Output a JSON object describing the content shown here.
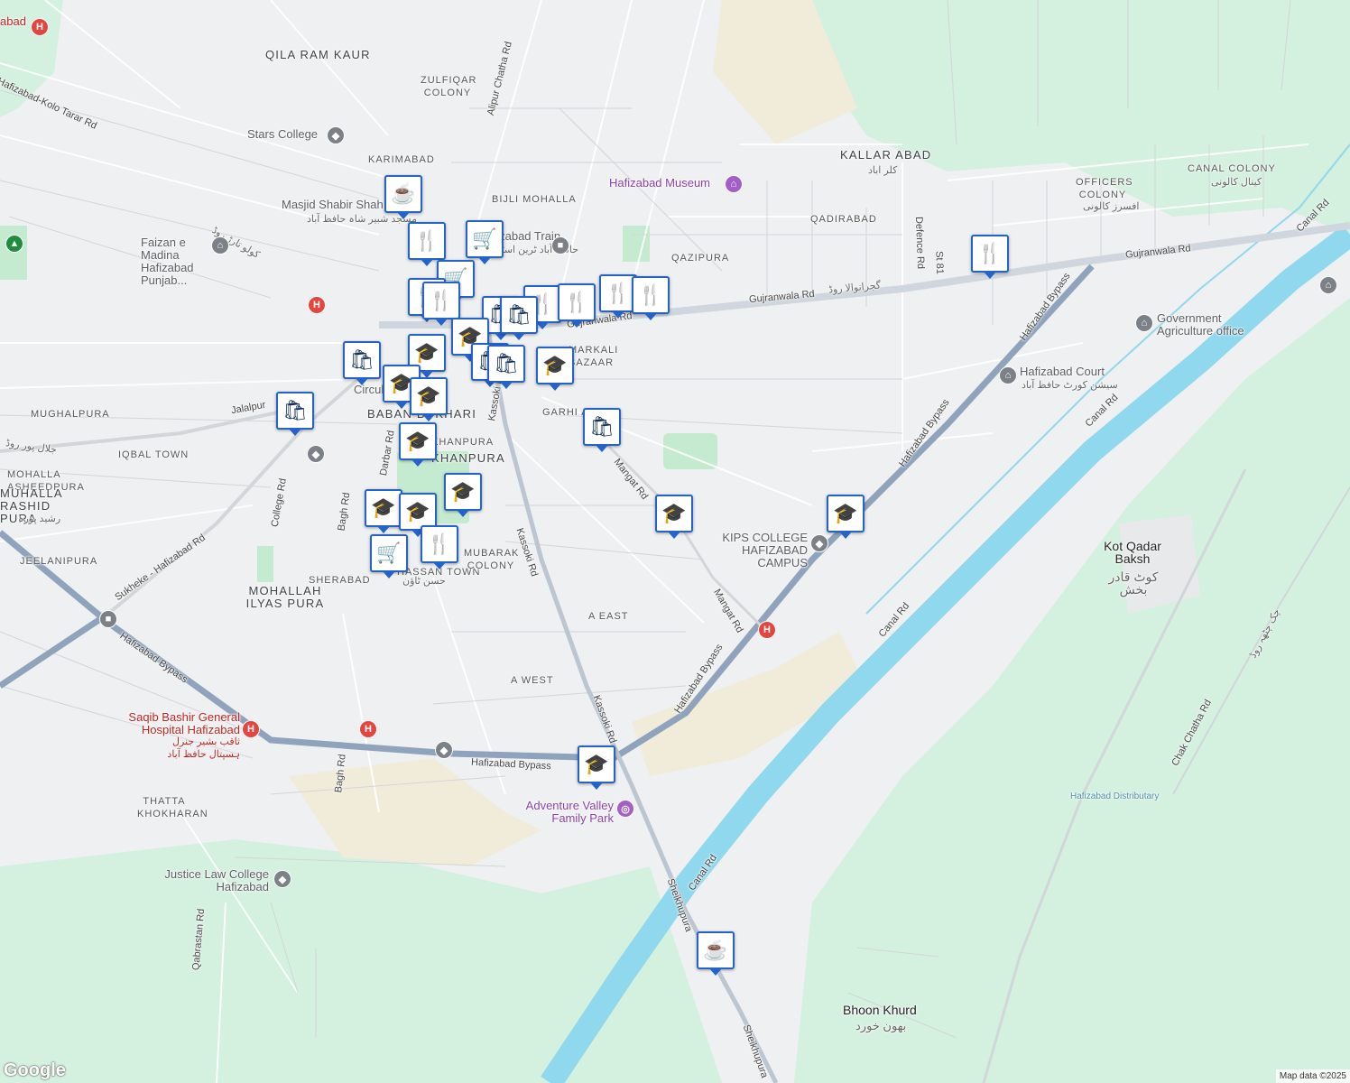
{
  "areas": {
    "qila_ram_kaur": "QILA RAM KAUR",
    "zulfiqar_colony": "ZULFIQAR COLONY",
    "karimabad": "KARIMABAD",
    "bijli_mohalla": "BIJLI MOHALLA",
    "kallar_abad": "KALLAR ABAD",
    "kallar_abad_urdu": "کلر اباد",
    "canal_colony": "CANAL COLONY",
    "canal_colony_urdu": "کینال کالونی",
    "officers_colony": "OFFICERS COLONY",
    "officers_colony_urdu": "افسرز کالونی",
    "qadirabad": "QADIRABAD",
    "qazipura": "QAZIPURA",
    "mughalpura": "MUGHALPURA",
    "iqbal_town": "IQBAL TOWN",
    "baban_bukhari": "BABAN BUKHARI",
    "khanpura": "KHANPURA",
    "khanpura_small": "KHANPURA",
    "mohalla_nasheedpura": "MOHALLA ASHEEDPURA",
    "muhalla_rashid_pura": "MUHALLA RASHID PURA",
    "rashid_pura_urdu": "رشید پورہ",
    "jeelanipura": "JEELANIPURA",
    "sherabad": "SHERABAD",
    "hassan_town": "HASSAN TOWN",
    "hassan_town_urdu": "حسن ٹاؤن",
    "mubarak_colony": "MUBARAK COLONY",
    "mohallah_ilyas_pura": "MOHALLAH ILYAS PURA",
    "a_east": "A EAST",
    "a_west": "A WEST",
    "thatta_khokharan": "THATTA KHOKHARAN",
    "garhi_awan": "GARHI A",
    "markali_bazaar": "MARKALI BAZAAR",
    "kot_qadar_baksh": "Kot Qadar Baksh",
    "kot_qadar_baksh_urdu": "کوٹ قادر بخش",
    "bhoon_khurd": "Bhoon Khurd",
    "bhoon_khurd_urdu": "بھون خورد",
    "circular": "Circul"
  },
  "roads": {
    "alipur_chatha_rd": "Alipur Chatha Rd",
    "gujranwala_rd_1": "Gujranwala Rd",
    "gujranwala_rd_2": "Gujranwala Rd",
    "gujranwala_rd_3": "Gujranwala Rd",
    "gujranwala_urdu": "گجرانوالا روڈ",
    "hafizabad_kolo_tarar_rd": "Hafizabad-Kolo Tarar Rd",
    "kolo_tarar_urdu": "کولو تارڑ روڈ",
    "jalalpur_rd": "Jalalpur",
    "jalalpur_urdu": "جلال پور روڈ",
    "darbar_rd": "Darbar Rd",
    "college_rd": "College Rd",
    "kassoki_rd_1": "Kassoki Rd",
    "kassoki_rd_2": "Kassoki Rd",
    "kassoki_rd_3": "Kassoki Rd",
    "mangat_rd_1": "Mangat Rd",
    "mangat_rd_2": "Mangat Rd",
    "sukheke_hafizabad_rd": "Sukheke - Hafizabad Rd",
    "hafizabad_bypass_1": "Hafizabad Bypass",
    "hafizabad_bypass_2": "Hafizabad Bypass",
    "hafizabad_bypass_3": "Hafizabad Bypass",
    "hafizabad_bypass_4": "Hafizabad Bypass",
    "hafizabad_bypass_5": "Hafizabad Bypass",
    "bagh_rd_1": "Bagh Rd",
    "bagh_rd_2": "Bagh Rd",
    "qabrastan_rd": "Qabrastan Rd",
    "canal_rd_1": "Canal Rd",
    "canal_rd_2": "Canal Rd",
    "canal_rd_3": "Canal Rd",
    "canal_rd_4": "Canal Rd",
    "sheikhupura_1": "Sheikhupura",
    "sheikhupura_2": "Sheikhupura",
    "defence_rd": "Defence Rd",
    "st_81": "St 81",
    "chak_chatha_rd": "Chak Chatha Rd",
    "chak_chatha_urdu": "چک چٹھہ روڈ"
  },
  "pois": {
    "stars_college": "Stars College",
    "masjid_shabir_shah": "Masjid Shabir Shah",
    "masjid_urdu": "مسجد شبیر شاہ حافظ آباد",
    "faizan_e_madina": "Faizan e Madina Hafizabad Punjab...",
    "hafizabad_museum": "Hafizabad Museum",
    "hafizabad_train": "Hafizabad Train",
    "train_urdu": "حافظ آباد ٹرین اسٹیشن",
    "government_agriculture": "Government Agriculture office",
    "hafizabad_court": "Hafizabad Court",
    "court_urdu": "سیشن کورٹ حافظ آباد",
    "kips_college": "KIPS COLLEGE HAFIZABAD CAMPUS",
    "saqib_bashir_hospital": "Saqib Bashir General Hospital Hafizabad",
    "saqib_urdu": "ثاقب بشیر جنرل ہسپتال حافظ آباد",
    "adventure_valley": "Adventure Valley Family Park",
    "justice_law_college": "Justice Law College Hafizabad",
    "hafizabad_top": "abad",
    "hafizabad_distributary": "Hafizabad Distributary"
  },
  "pins": [
    {
      "type": "coffee",
      "icon": "☕"
    },
    {
      "type": "restaurant",
      "icon": "🍴"
    },
    {
      "type": "grocery",
      "icon": "🛒"
    },
    {
      "type": "grocery",
      "icon": "🛒"
    },
    {
      "type": "restaurant",
      "icon": "🍴"
    },
    {
      "type": "restaurant",
      "icon": "🍴"
    },
    {
      "type": "restaurant",
      "icon": "🍴"
    },
    {
      "type": "restaurant",
      "icon": "🍴"
    },
    {
      "type": "restaurant",
      "icon": "🍴"
    },
    {
      "type": "restaurant",
      "icon": "🍴"
    },
    {
      "type": "shopping",
      "icon": "🛍"
    },
    {
      "type": "shopping",
      "icon": "🛍"
    },
    {
      "type": "school",
      "icon": "🎓"
    },
    {
      "type": "shopping",
      "icon": "🛍"
    },
    {
      "type": "school",
      "icon": "🎓"
    },
    {
      "type": "school",
      "icon": "🎓"
    },
    {
      "type": "school",
      "icon": "🎓"
    },
    {
      "type": "shopping",
      "icon": "🛍"
    },
    {
      "type": "shopping",
      "icon": "🛍"
    },
    {
      "type": "school",
      "icon": "🎓"
    },
    {
      "type": "shopping",
      "icon": "🛍"
    },
    {
      "type": "school",
      "icon": "🎓"
    },
    {
      "type": "school",
      "icon": "🎓"
    },
    {
      "type": "school",
      "icon": "🎓"
    },
    {
      "type": "school",
      "icon": "🎓"
    },
    {
      "type": "grocery",
      "icon": "🛒"
    },
    {
      "type": "restaurant",
      "icon": "🍴"
    },
    {
      "type": "school",
      "icon": "🎓"
    },
    {
      "type": "school",
      "icon": "🎓"
    },
    {
      "type": "restaurant",
      "icon": "🍴"
    },
    {
      "type": "coffee",
      "icon": "☕"
    }
  ],
  "footer": {
    "google_logo": "Google",
    "attribution": "Map data ©2025"
  },
  "colors": {
    "background": "#eef0f1",
    "park_green": "#cdeedb",
    "canal": "#8fd8ee",
    "bypass": "#8fa3bd",
    "pin_border": "#2563c9",
    "pin_icon": "#0d2e57"
  }
}
